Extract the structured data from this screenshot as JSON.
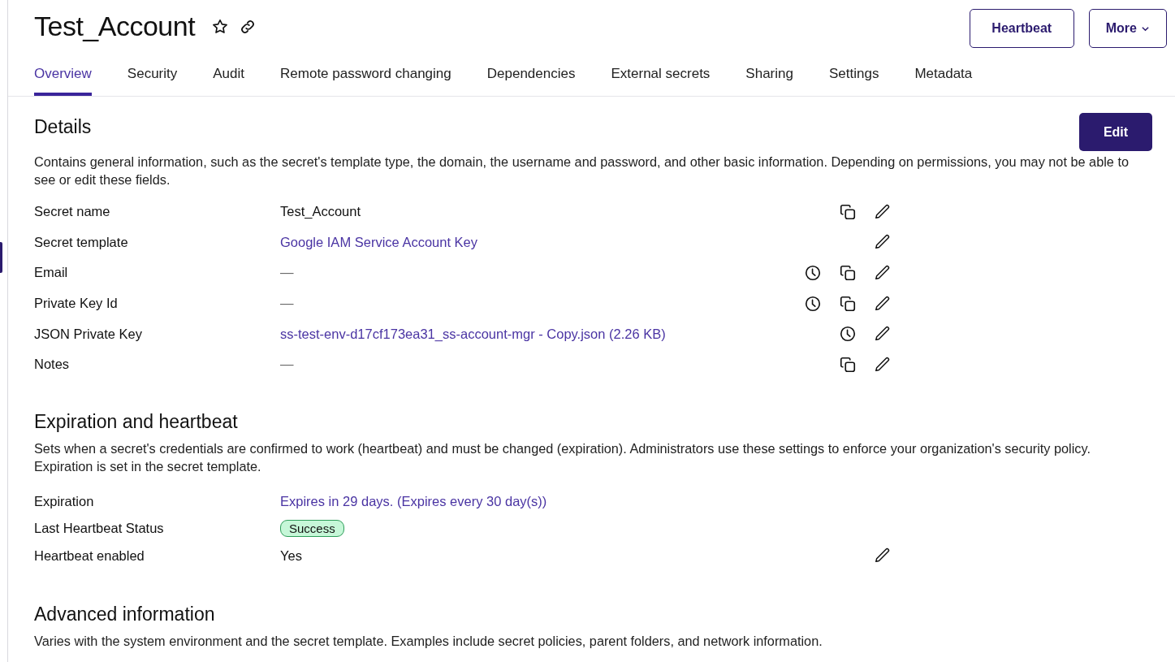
{
  "header": {
    "title": "Test_Account",
    "buttons": [
      {
        "label": "Heartbeat",
        "kind": "plain"
      },
      {
        "label": "More",
        "kind": "dropdown"
      }
    ]
  },
  "tabs": [
    {
      "label": "Overview",
      "selected": true
    },
    {
      "label": "Security",
      "selected": false
    },
    {
      "label": "Audit",
      "selected": false
    },
    {
      "label": "Remote password changing",
      "selected": false
    },
    {
      "label": "Dependencies",
      "selected": false
    },
    {
      "label": "External secrets",
      "selected": false
    },
    {
      "label": "Sharing",
      "selected": false
    },
    {
      "label": "Settings",
      "selected": false
    },
    {
      "label": "Metadata",
      "selected": false
    }
  ],
  "details": {
    "title": "Details",
    "edit_button": "Edit",
    "description": "Contains general information, such as the secret's template type, the domain, the username and password, and other basic information. Depending on permissions, you may not be able to see or edit these fields.",
    "fields": [
      {
        "label": "Secret name",
        "value": "Test_Account",
        "kind": "text",
        "actions": [
          {
            "kind": "copy"
          },
          {
            "kind": "edit"
          }
        ]
      },
      {
        "label": "Secret template",
        "value": "Google IAM Service Account Key",
        "kind": "link",
        "actions": [
          {
            "kind": "edit"
          }
        ]
      },
      {
        "label": "Email",
        "value": "—",
        "kind": "empty",
        "actions": [
          {
            "kind": "history"
          },
          {
            "kind": "copy"
          },
          {
            "kind": "edit"
          }
        ]
      },
      {
        "label": "Private Key Id",
        "value": "—",
        "kind": "empty",
        "actions": [
          {
            "kind": "history"
          },
          {
            "kind": "copy"
          },
          {
            "kind": "edit"
          }
        ]
      },
      {
        "label": "JSON Private Key",
        "value": "ss-test-env-d17cf173ea31_ss-account-mgr - Copy.json (2.26 KB)",
        "kind": "link",
        "actions": [
          {
            "kind": "history"
          },
          {
            "kind": "edit"
          }
        ]
      },
      {
        "label": "Notes",
        "value": "—",
        "kind": "empty",
        "actions": [
          {
            "kind": "copy"
          },
          {
            "kind": "edit"
          }
        ]
      }
    ]
  },
  "expiration": {
    "title": "Expiration and heartbeat",
    "description": "Sets when a secret's credentials are confirmed to work (heartbeat) and must be changed (expiration). Administrators use these settings to enforce your organization's security policy. Expiration is set in the secret template.",
    "fields": [
      {
        "label": "Expiration",
        "value": "Expires in 29 days. (Expires every 30 day(s))",
        "kind": "link"
      },
      {
        "label": "Last Heartbeat Status",
        "value": "Success",
        "kind": "badge"
      },
      {
        "label": "Heartbeat enabled",
        "value": "Yes",
        "kind": "text",
        "actions": [
          {
            "kind": "edit"
          }
        ]
      }
    ]
  },
  "advanced": {
    "title": "Advanced information",
    "description": "Varies with the system environment and the secret template. Examples include secret policies, parent folders, and network information."
  }
}
